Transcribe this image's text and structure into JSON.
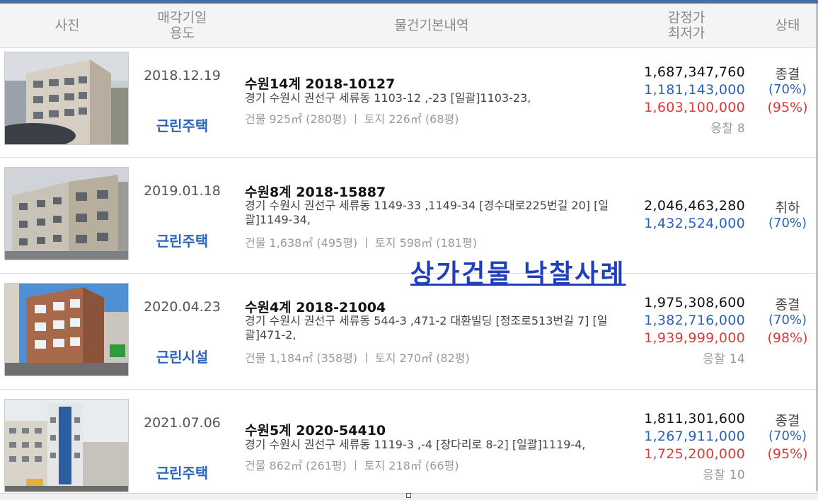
{
  "header": {
    "photo": "사진",
    "date_line1": "매각기일",
    "date_line2": "용도",
    "info": "물건기본내역",
    "price_line1": "감정가",
    "price_line2": "최저가",
    "status": "상태"
  },
  "overlay_text": "상가건물  낙찰사례",
  "rows": [
    {
      "date": "2018.12.19",
      "use": "근린주택",
      "title": "수원14계 2018-10127",
      "address": "경기 수원시 권선구 세류동 1103-12 ,-23  [일괄]1103-23,",
      "area": "건물 925㎡ (280평)   ㅣ  토지 226㎡ (68평)",
      "appraisal": "1,687,347,760",
      "minimum": "1,181,143,000",
      "winning": "1,603,100,000",
      "bids": "응찰 8",
      "status": "종결",
      "min_pct": "(70%)",
      "win_pct": "(95%)"
    },
    {
      "date": "2019.01.18",
      "use": "근린주택",
      "title": "수원8계 2018-15887",
      "address": "경기 수원시 권선구 세류동 1149-33 ,1149-34 [경수대로225번길 20] [일괄]1149-34,",
      "area": "건물 1,638㎡ (495평)   ㅣ  토지 598㎡ (181평)",
      "appraisal": "2,046,463,280",
      "minimum": "1,432,524,000",
      "status": "취하",
      "min_pct": "(70%)"
    },
    {
      "date": "2020.04.23",
      "use": "근린시설",
      "title": "수원4계 2018-21004",
      "address": "경기 수원시 권선구 세류동 544-3 ,471-2 대환빌딩 [정조로513번길 7] [일괄]471-2,",
      "area": "건물 1,184㎡ (358평)   ㅣ  토지 270㎡ (82평)",
      "appraisal": "1,975,308,600",
      "minimum": "1,382,716,000",
      "winning": "1,939,999,000",
      "bids": "응찰 14",
      "status": "종결",
      "min_pct": "(70%)",
      "win_pct": "(98%)"
    },
    {
      "date": "2021.07.06",
      "use": "근린주택",
      "title": "수원5계 2020-54410",
      "address": "경기 수원시 권선구 세류동 1119-3 ,-4 [장다리로 8-2]  [일괄]1119-4,",
      "area": "건물 862㎡ (261평)   ㅣ  토지 218㎡ (66평)",
      "appraisal": "1,811,301,600",
      "minimum": "1,267,911,000",
      "winning": "1,725,200,000",
      "bids": "응찰 10",
      "status": "종결",
      "min_pct": "(70%)",
      "win_pct": "(95%)"
    }
  ],
  "colors": {
    "accent_blue": "#2a63b8",
    "price_red": "#e03a3a",
    "overlay_blue": "#1f3fbd",
    "header_bg": "#f4f4f4"
  }
}
